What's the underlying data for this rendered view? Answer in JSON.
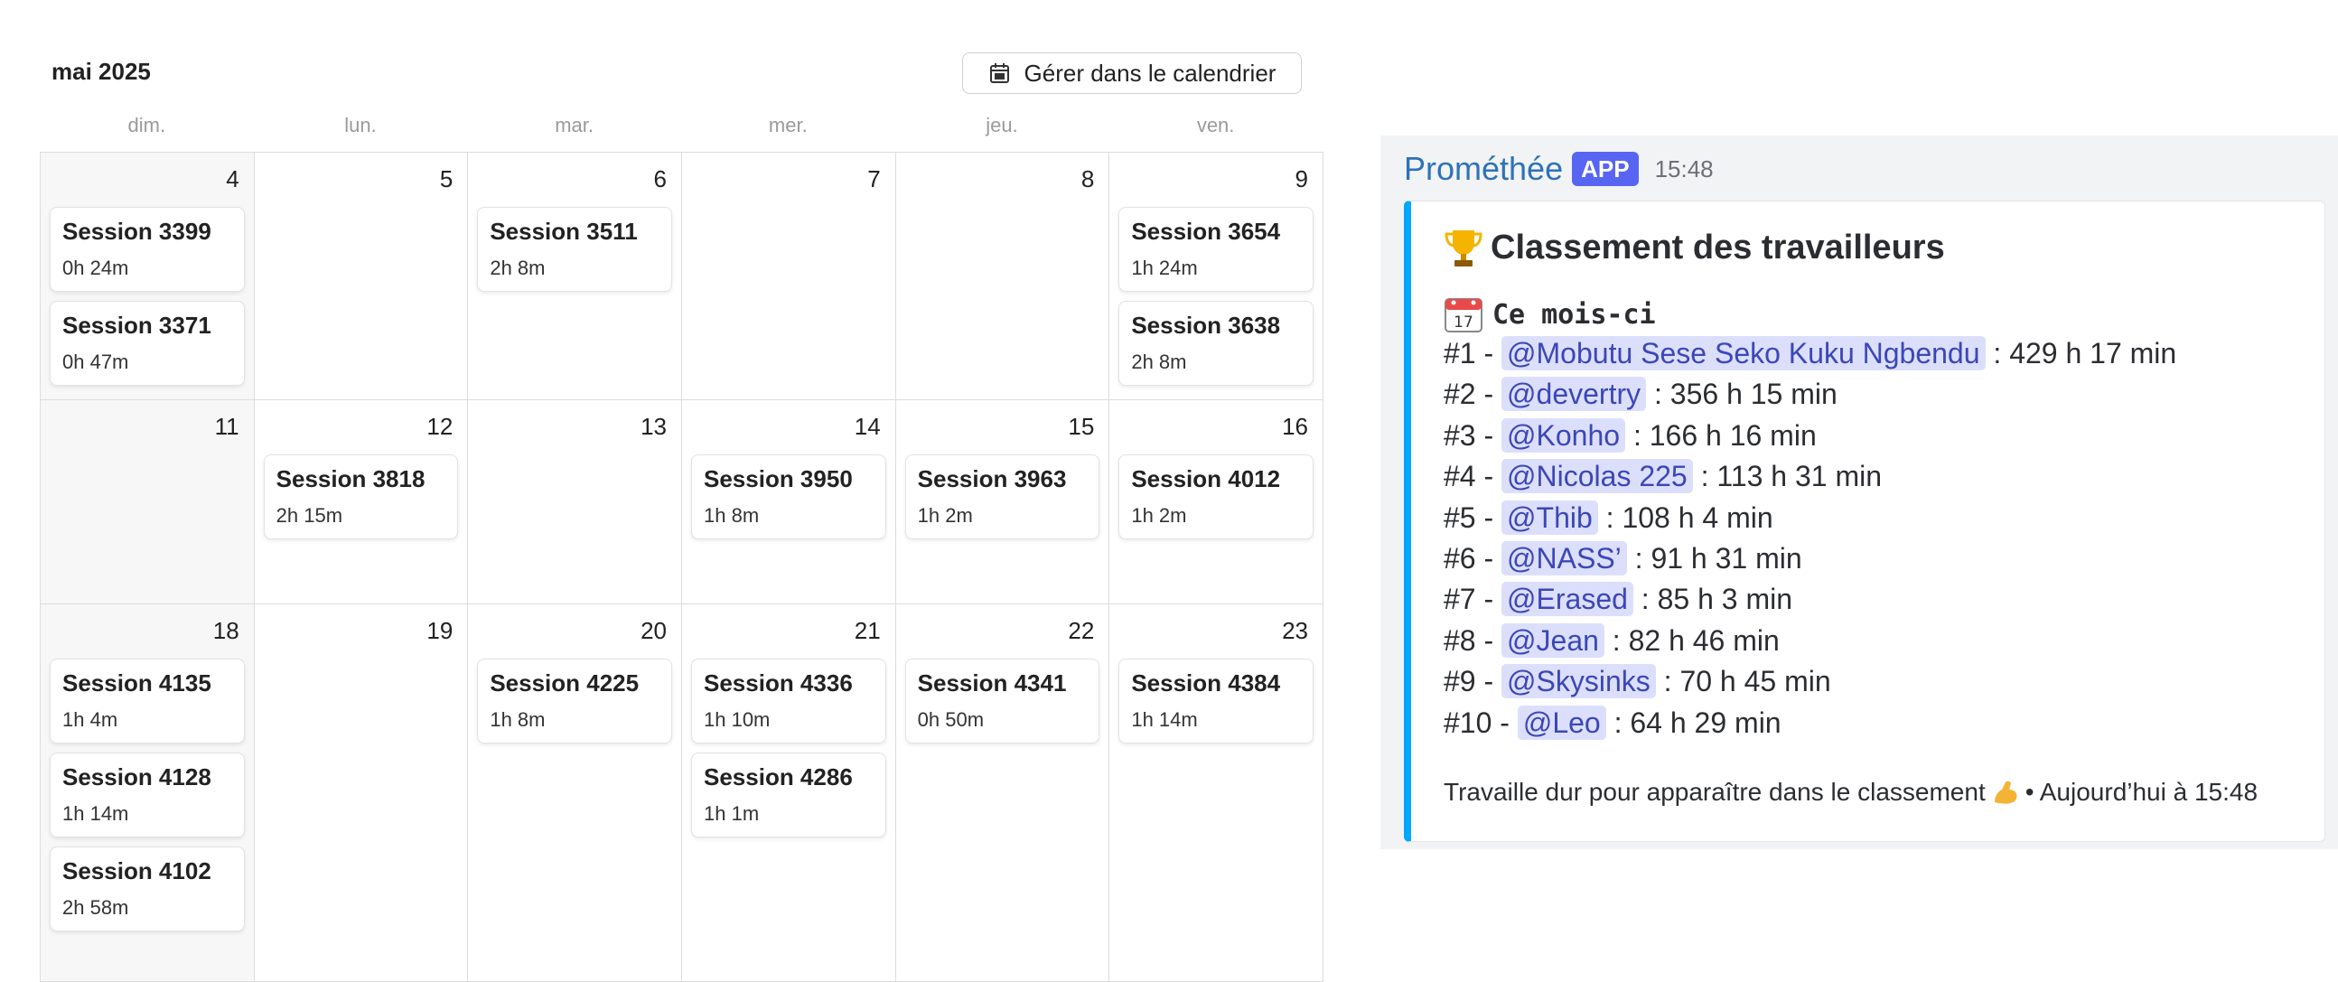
{
  "calendar": {
    "title": "mai 2025",
    "manage_button": "Gérer dans le calendrier",
    "weekdays": [
      "dim.",
      "lun.",
      "mar.",
      "mer.",
      "jeu.",
      "ven."
    ],
    "weeks": [
      [
        {
          "day": "4",
          "sessions": [
            {
              "title": "Session 3399",
              "duration": "0h 24m"
            },
            {
              "title": "Session 3371",
              "duration": "0h 47m"
            }
          ]
        },
        {
          "day": "5",
          "sessions": []
        },
        {
          "day": "6",
          "sessions": [
            {
              "title": "Session 3511",
              "duration": "2h 8m"
            }
          ]
        },
        {
          "day": "7",
          "sessions": []
        },
        {
          "day": "8",
          "sessions": []
        },
        {
          "day": "9",
          "sessions": [
            {
              "title": "Session 3654",
              "duration": "1h 24m"
            },
            {
              "title": "Session 3638",
              "duration": "2h 8m"
            }
          ]
        }
      ],
      [
        {
          "day": "11",
          "sessions": []
        },
        {
          "day": "12",
          "sessions": [
            {
              "title": "Session 3818",
              "duration": "2h 15m"
            }
          ]
        },
        {
          "day": "13",
          "sessions": []
        },
        {
          "day": "14",
          "sessions": [
            {
              "title": "Session 3950",
              "duration": "1h 8m"
            }
          ]
        },
        {
          "day": "15",
          "sessions": [
            {
              "title": "Session 3963",
              "duration": "1h 2m"
            }
          ]
        },
        {
          "day": "16",
          "sessions": [
            {
              "title": "Session 4012",
              "duration": "1h 2m"
            }
          ]
        }
      ],
      [
        {
          "day": "18",
          "sessions": [
            {
              "title": "Session 4135",
              "duration": "1h 4m"
            },
            {
              "title": "Session 4128",
              "duration": "1h 14m"
            },
            {
              "title": "Session 4102",
              "duration": "2h 58m"
            }
          ]
        },
        {
          "day": "19",
          "sessions": []
        },
        {
          "day": "20",
          "sessions": [
            {
              "title": "Session 4225",
              "duration": "1h 8m"
            }
          ]
        },
        {
          "day": "21",
          "sessions": [
            {
              "title": "Session 4336",
              "duration": "1h 10m"
            },
            {
              "title": "Session 4286",
              "duration": "1h 1m"
            }
          ]
        },
        {
          "day": "22",
          "sessions": [
            {
              "title": "Session 4341",
              "duration": "0h 50m"
            }
          ]
        },
        {
          "day": "23",
          "sessions": [
            {
              "title": "Session 4384",
              "duration": "1h 14m"
            }
          ]
        }
      ]
    ]
  },
  "message": {
    "author": "Prométhée",
    "badge": "APP",
    "time": "15:48",
    "embed": {
      "title": "Classement des travailleurs",
      "title_icon": "trophy-icon",
      "period_icon": "calendar-date-icon",
      "period": "Ce mois-ci",
      "ranking": [
        {
          "rank": "#1 -",
          "user": "@Mobutu Sese Seko Kuku Ngbendu",
          "time": ": 429 h 17 min"
        },
        {
          "rank": "#2 -",
          "user": "@devertry",
          "time": ": 356 h 15 min"
        },
        {
          "rank": "#3 -",
          "user": "@Konho",
          "time": ": 166 h 16 min"
        },
        {
          "rank": "#4 -",
          "user": "@Nicolas 225",
          "time": ": 113 h 31 min"
        },
        {
          "rank": "#5 -",
          "user": "@Thib",
          "time": ": 108 h 4 min"
        },
        {
          "rank": "#6 -",
          "user": "@NASS’",
          "time": ": 91 h 31 min"
        },
        {
          "rank": "#7 -",
          "user": "@Erased",
          "time": ": 85 h 3 min"
        },
        {
          "rank": "#8 -",
          "user": "@Jean",
          "time": ": 82 h 46 min"
        },
        {
          "rank": "#9 -",
          "user": "@Skysinks",
          "time": ": 70 h 45 min"
        },
        {
          "rank": "#10 -",
          "user": "@Leo",
          "time": ": 64 h 29 min"
        }
      ],
      "footer_text": "Travaille dur pour apparaître dans le classement",
      "footer_icon": "flexed-biceps-icon",
      "footer_suffix": "• Aujourd’hui à 15:48"
    }
  },
  "colors": {
    "embed_accent": "#00a8fc",
    "badge": "#5865f2",
    "author": "#2d73b7",
    "mention_bg": "#dcdffb",
    "mention_text": "#3b47b8"
  }
}
